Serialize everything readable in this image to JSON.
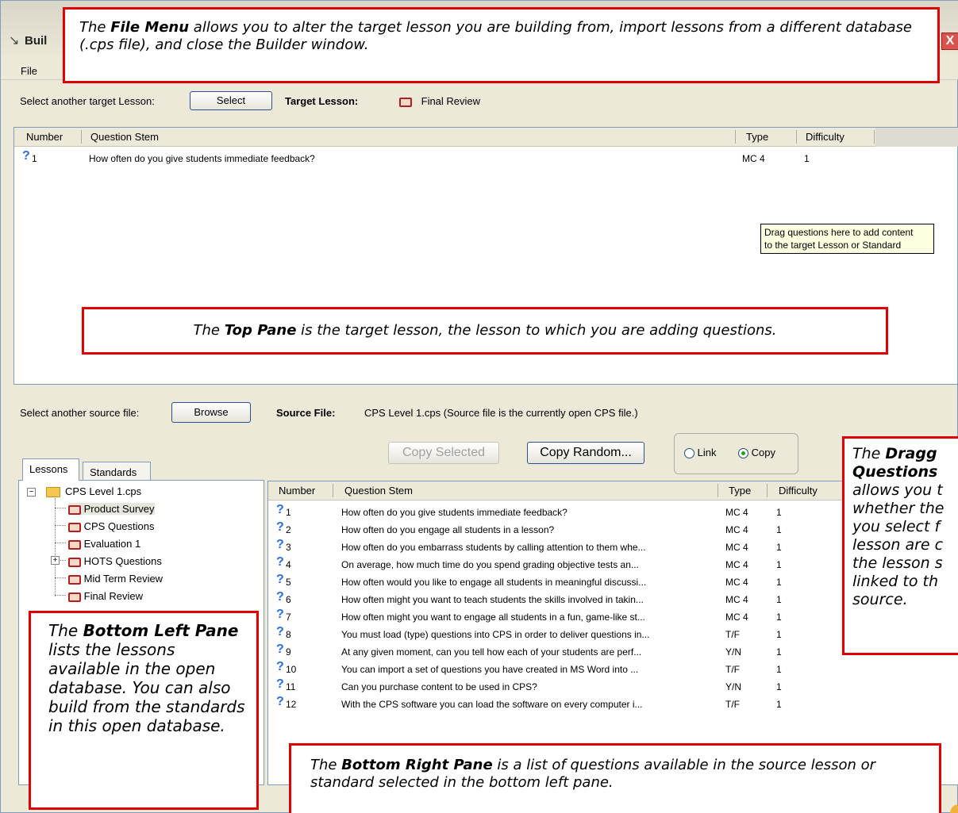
{
  "window": {
    "title": "Buil",
    "close_glyph": "X"
  },
  "menu": {
    "file": "File"
  },
  "target": {
    "select_label": "Select another target Lesson:",
    "select_button": "Select",
    "target_lesson_label": "Target Lesson:",
    "target_lesson_value": "Final Review"
  },
  "columns": {
    "number": "Number",
    "stem": "Question Stem",
    "type": "Type",
    "difficulty": "Difficulty"
  },
  "target_questions": [
    {
      "number": "1",
      "stem": "How often do you give students immediate feedback?",
      "type": "MC 4",
      "difficulty": "1"
    }
  ],
  "tooltip": {
    "line1": "Drag questions here to add content",
    "line2": "to the target Lesson or Standard"
  },
  "source": {
    "browse_label": "Select another source file:",
    "browse_button": "Browse",
    "source_file_label": "Source File:",
    "source_file_value": "CPS Level 1.cps  (Source file is the currently open CPS file.)",
    "copy_selected": "Copy Selected",
    "copy_random": "Copy Random...",
    "link_label": "Link",
    "copy_label": "Copy",
    "selected_mode": "Copy"
  },
  "tabs": {
    "lessons": "Lessons",
    "standards": "Standards"
  },
  "tree": {
    "root": "CPS Level 1.cps",
    "items": [
      "Product Survey",
      "CPS Questions",
      "Evaluation 1",
      "HOTS Questions",
      "Mid Term Review",
      "Final Review"
    ]
  },
  "source_questions": [
    {
      "number": "1",
      "stem": "How often do you give students immediate feedback?",
      "type": "MC 4",
      "difficulty": "1"
    },
    {
      "number": "2",
      "stem": "How often do you engage all students in a lesson?",
      "type": "MC 4",
      "difficulty": "1"
    },
    {
      "number": "3",
      "stem": "How often do you embarrass students by calling attention to them whe...",
      "type": "MC 4",
      "difficulty": "1"
    },
    {
      "number": "4",
      "stem": "On average, how much time do you spend  grading objective tests an...",
      "type": "MC 4",
      "difficulty": "1"
    },
    {
      "number": "5",
      "stem": "How often would you like to engage all students in meaningful discussi...",
      "type": "MC 4",
      "difficulty": "1"
    },
    {
      "number": "6",
      "stem": "How often might you want to teach students the skills involved in takin...",
      "type": "MC 4",
      "difficulty": "1"
    },
    {
      "number": "7",
      "stem": "How often might you want to engage all students in a fun, game-like st...",
      "type": "MC 4",
      "difficulty": "1"
    },
    {
      "number": "8",
      "stem": "You must load (type) questions into CPS in order to deliver questions in...",
      "type": "T/F",
      "difficulty": "1"
    },
    {
      "number": "9",
      "stem": "At any given moment, can you tell how each of your students are perf...",
      "type": "Y/N",
      "difficulty": "1"
    },
    {
      "number": "10",
      "stem": "You can import a set of questions you have created in MS Word into ...",
      "type": "T/F",
      "difficulty": "1"
    },
    {
      "number": "11",
      "stem": "Can you purchase content to be used in CPS?",
      "type": "Y/N",
      "difficulty": "1"
    },
    {
      "number": "12",
      "stem": "With the CPS software you can load the software on every computer i...",
      "type": "T/F",
      "difficulty": "1"
    }
  ],
  "callouts": {
    "file_menu": {
      "pre": "The ",
      "bold": "File Menu",
      "post": " allows you to alter the target lesson you are building from, import lessons from a different database (.cps file), and close the Builder window."
    },
    "top_pane": {
      "pre": "The ",
      "bold": "Top Pane",
      "post": " is the target lesson, the lesson to which you are adding questions."
    },
    "bottom_left": {
      "pre": "The ",
      "bold": "Bottom Left Pane",
      "post": " lists the lessons available in the open database. You can also build from the standards in this open database."
    },
    "bottom_right": {
      "pre": "The ",
      "bold": "Bottom Right Pane",
      "post": " is a list of questions available in the source lesson or standard selected in the bottom left pane."
    },
    "dragged": {
      "pre": "The ",
      "bold": "Dragg",
      "bold2": "Questions",
      "lines": [
        "allows you t",
        "whether the",
        "you select f",
        "lesson are c",
        "the lesson s",
        "linked to th",
        "source."
      ]
    }
  }
}
